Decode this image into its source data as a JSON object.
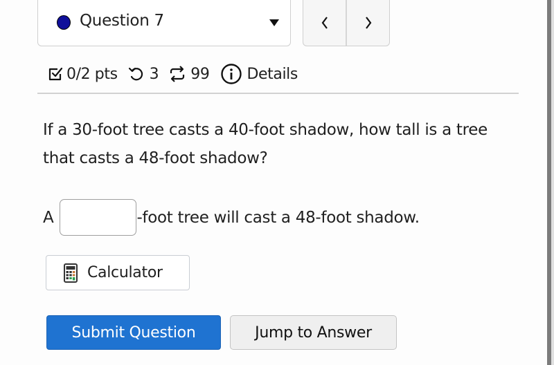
{
  "question_selector": {
    "label": "Question 7",
    "status_color": "#0f0f9a",
    "status_icon": "filled-circle-icon",
    "dropdown_icon": "caret-down-icon"
  },
  "navigation": {
    "prev_label": "‹",
    "next_label": "›"
  },
  "meta": {
    "points": "0/2 pts",
    "retries": "3",
    "attempts": "99",
    "details_label": "Details"
  },
  "question": {
    "text": "If a 30-foot tree casts a 40-foot shadow, how tall is a tree that casts a 48-foot shadow?"
  },
  "answer": {
    "prefix": "A",
    "value": "",
    "suffix": "-foot tree will cast a 48-foot shadow."
  },
  "buttons": {
    "calculator": "Calculator",
    "submit": "Submit Question",
    "jump": "Jump to Answer"
  },
  "colors": {
    "submit_bg": "#1f73d1"
  }
}
